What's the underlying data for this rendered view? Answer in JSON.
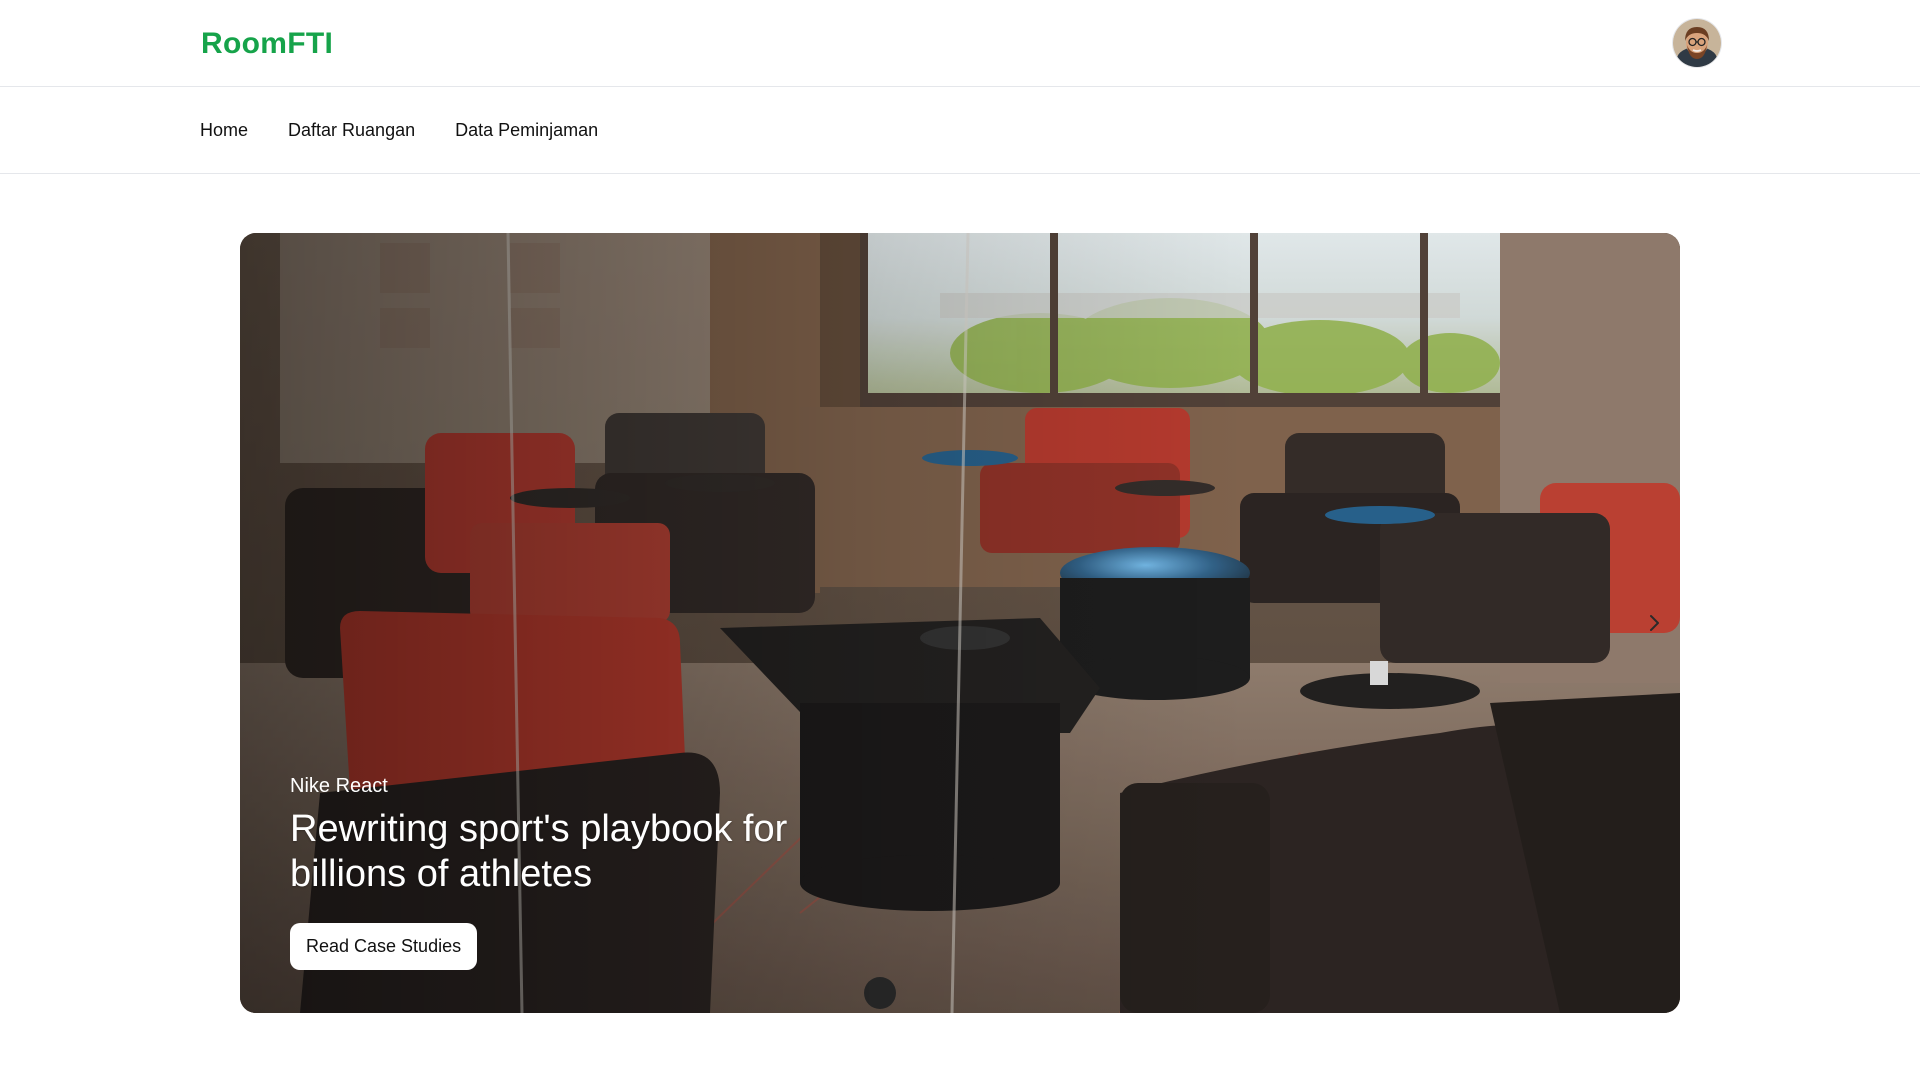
{
  "header": {
    "brand": "RoomFTI",
    "avatar_icon": "user-avatar"
  },
  "nav": {
    "items": [
      {
        "label": "Home"
      },
      {
        "label": "Daftar Ruangan"
      },
      {
        "label": "Data Peminjaman"
      }
    ]
  },
  "hero": {
    "eyebrow": "Nike React",
    "title_line1": "Rewriting sport's playbook for",
    "title_line2": "billions of athletes",
    "cta_label": "Read Case Studies",
    "next_icon": "chevron-right-icon"
  },
  "colors": {
    "brand": "#16a34a",
    "text": "#111111",
    "border": "#e5e7eb",
    "button_bg": "#ffffff"
  }
}
